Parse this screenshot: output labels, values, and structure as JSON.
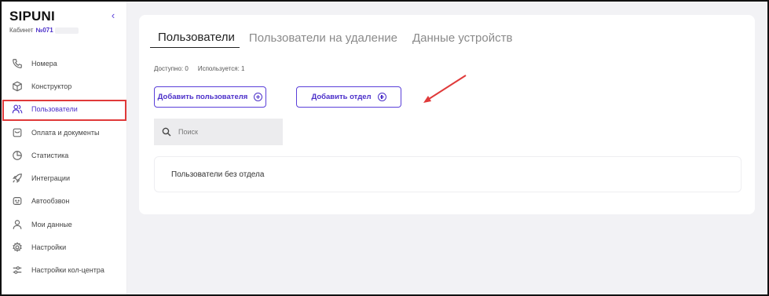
{
  "app": {
    "logo": "SIPUNI",
    "collapse_icon": "chevron-left-icon",
    "cabinet_label": "Кабинет",
    "cabinet_number": "№071"
  },
  "sidebar": {
    "items": [
      {
        "label": "Номера",
        "icon": "phone-icon"
      },
      {
        "label": "Конструктор",
        "icon": "cube-icon"
      },
      {
        "label": "Пользователи",
        "icon": "users-icon",
        "active": true
      },
      {
        "label": "Оплата и документы",
        "icon": "wallet-icon"
      },
      {
        "label": "Статистика",
        "icon": "pie-chart-icon"
      },
      {
        "label": "Интеграции",
        "icon": "rocket-icon"
      },
      {
        "label": "Автообзвон",
        "icon": "bot-icon"
      },
      {
        "label": "Мои данные",
        "icon": "user-icon"
      },
      {
        "label": "Настройки",
        "icon": "gear-icon"
      },
      {
        "label": "Настройки кол-центра",
        "icon": "sliders-icon"
      }
    ]
  },
  "main": {
    "tabs": [
      {
        "label": "Пользователи",
        "active": true
      },
      {
        "label": "Пользователи на удаление",
        "active": false
      },
      {
        "label": "Данные устройств",
        "active": false
      }
    ],
    "available": "Доступно: 0",
    "used": "Используется: 1",
    "add_user_label": "Добавить пользователя",
    "add_department_label": "Добавить отдел",
    "search_placeholder": "Поиск",
    "group_label": "Пользователи без отдела"
  },
  "colors": {
    "accent": "#4b2fc9",
    "highlight": "#e03a3a",
    "background": "#f2f2f5"
  }
}
